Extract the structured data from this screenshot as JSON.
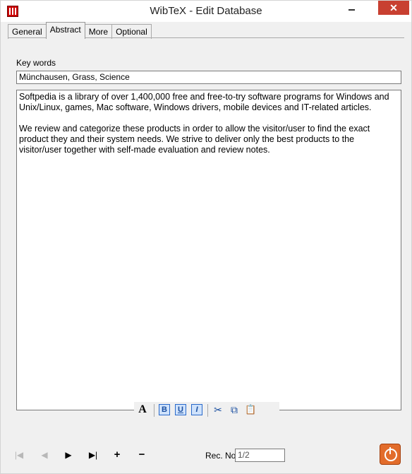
{
  "window": {
    "title": "WibTeX - Edit Database",
    "close_label": "✕"
  },
  "tabs": [
    {
      "label": "General"
    },
    {
      "label": "Abstract"
    },
    {
      "label": "More"
    },
    {
      "label": "Optional"
    }
  ],
  "keywords": {
    "label": "Key words",
    "value": "Münchausen, Grass, Science"
  },
  "abstract": {
    "text": "Softpedia is a library of over 1,400,000 free and free-to-try software programs for Windows and Unix/Linux, games, Mac software, Windows drivers, mobile devices and IT-related articles.\n\nWe review and categorize these products in order to allow the visitor/user to find the exact product they and their system needs. We strive to deliver only the best products to the visitor/user together with self-made evaluation and review notes."
  },
  "format_toolbar": {
    "font": "A",
    "bold": "B",
    "underline": "U",
    "italic": "I",
    "cut": "✂",
    "copy": "⧉",
    "paste": "📋"
  },
  "navigation": {
    "first": "|◀",
    "prev": "◀",
    "next": "▶",
    "last": "▶|",
    "add": "+",
    "delete": "−"
  },
  "record": {
    "label": "Rec. No.",
    "value": "1/2"
  },
  "accent_colors": {
    "close": "#c84031",
    "power": "#e26c2b",
    "format_buttons": "#2a6acb"
  }
}
